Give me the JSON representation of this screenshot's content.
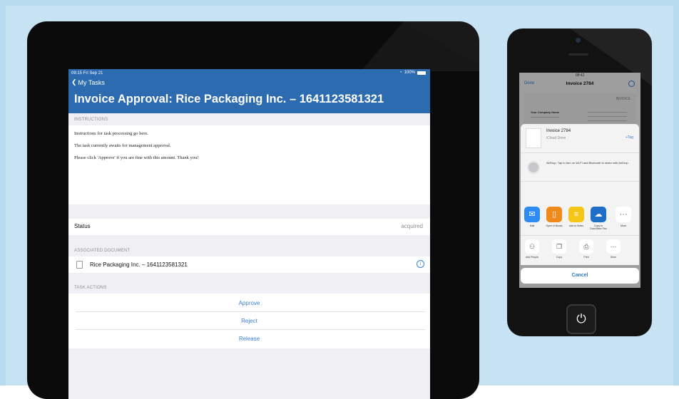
{
  "ipad": {
    "status_time": "09:15  Fri Sep 21",
    "status_battery": "100%",
    "back_label": "My Tasks",
    "title": "Invoice Approval: Rice Packaging Inc. – 1641123581321",
    "instructions_header": "INSTRUCTIONS",
    "instructions": [
      "Instructions for task processing go here.",
      "The task currently awaits for management approval.",
      "Please click 'Approve' if you are fine with this amount. Thank you!"
    ],
    "status_label": "Status",
    "status_value": "acquired",
    "associated_header": "ASSOCIATED DOCUMENT",
    "document_name": "Rice Packaging Inc. – 1641123581321",
    "task_actions_header": "TASK ACTIONS",
    "actions": [
      "Approve",
      "Reject",
      "Release"
    ]
  },
  "iphone": {
    "status_time": "08:42",
    "nav_done": "Done",
    "nav_title": "Invoice 2784",
    "preview_invoice": "INVOICE",
    "preview_company": "Your Company Name",
    "file_name": "Invoice 2784",
    "file_location": "iCloud Drive",
    "file_tag": "+Tag",
    "airdrop_text": "AirDrop. Tap to turn on Wi-Fi and Bluetooth to share with AirDrop.",
    "apps": [
      {
        "label": "Mail",
        "icon": "mail-icon",
        "color": "#2e8cf0"
      },
      {
        "label": "Open in Books",
        "icon": "books-icon",
        "color": "#f08a1c"
      },
      {
        "label": "Add to Notes",
        "icon": "notes-icon",
        "color": "#f5c518"
      },
      {
        "label": "Copy to DocuWare Pao",
        "icon": "docuware-icon",
        "color": "#1f6fc9"
      },
      {
        "label": "More",
        "icon": "more-icon",
        "color": "#ffffff"
      }
    ],
    "actions": [
      {
        "label": "Add People",
        "icon": "add-people-icon"
      },
      {
        "label": "Copy",
        "icon": "copy-icon"
      },
      {
        "label": "Print",
        "icon": "print-icon"
      },
      {
        "label": "More",
        "icon": "more-icon"
      }
    ],
    "cancel_label": "Cancel"
  },
  "colors": {
    "header_blue": "#2d6bb0",
    "link_blue": "#3b82d6",
    "background": "#c6e2f3"
  }
}
